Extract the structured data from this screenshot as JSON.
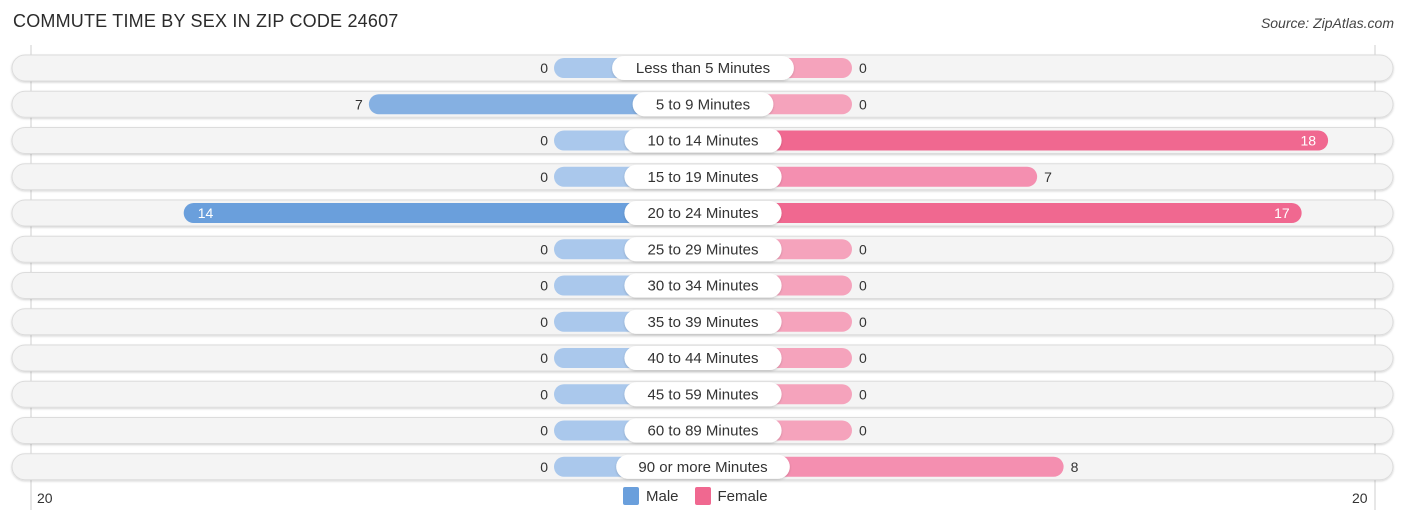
{
  "title": "COMMUTE TIME BY SEX IN ZIP CODE 24607",
  "source": "Source: ZipAtlas.com",
  "colors": {
    "male_strong": "#6a9fdc",
    "male_light": "#aac8ec",
    "female_strong": "#f06890",
    "female_light": "#f5a3bc",
    "track": "#f4f4f4"
  },
  "legend": [
    {
      "label": "Male",
      "color": "#6a9fdc"
    },
    {
      "label": "Female",
      "color": "#f06890"
    }
  ],
  "axis": {
    "left_label": "20",
    "right_label": "20"
  },
  "chart_data": {
    "type": "bar",
    "orientation": "horizontal-diverging",
    "title": "COMMUTE TIME BY SEX IN ZIP CODE 24607",
    "categories": [
      "Less than 5 Minutes",
      "5 to 9 Minutes",
      "10 to 14 Minutes",
      "15 to 19 Minutes",
      "20 to 24 Minutes",
      "25 to 29 Minutes",
      "30 to 34 Minutes",
      "35 to 39 Minutes",
      "40 to 44 Minutes",
      "45 to 59 Minutes",
      "60 to 89 Minutes",
      "90 or more Minutes"
    ],
    "series": [
      {
        "name": "Male",
        "side": "left",
        "values": [
          0,
          7,
          0,
          0,
          14,
          0,
          0,
          0,
          0,
          0,
          0,
          0
        ]
      },
      {
        "name": "Female",
        "side": "right",
        "values": [
          0,
          0,
          18,
          7,
          17,
          0,
          0,
          0,
          0,
          0,
          0,
          8
        ]
      }
    ],
    "xlim": [
      -20,
      20
    ],
    "tick_labels": [
      "20",
      "20"
    ],
    "legend_position": "bottom-center"
  }
}
